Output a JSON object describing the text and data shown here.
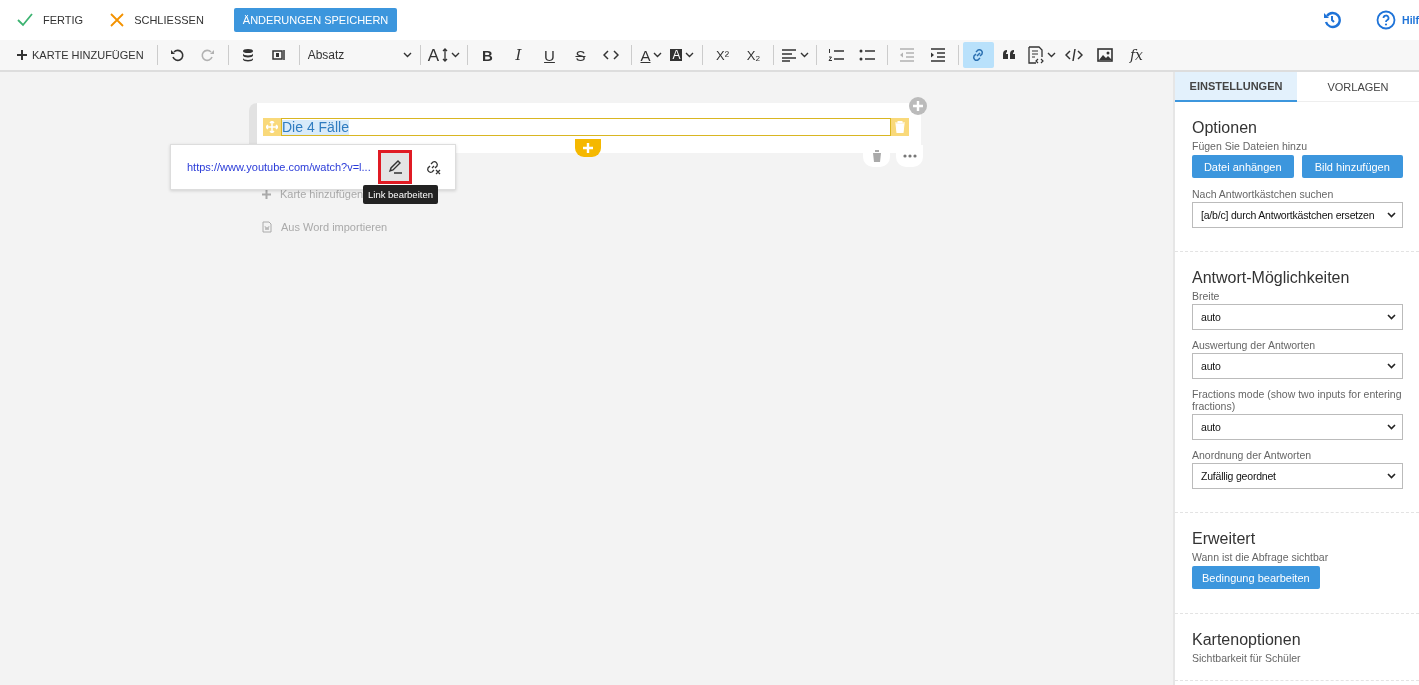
{
  "topbar": {
    "actions": [
      {
        "kind": "done",
        "label": "FERTIG"
      },
      {
        "kind": "close",
        "label": "SCHLIESSEN"
      }
    ],
    "save": "ÄNDERUNGEN SPEICHERN",
    "help": "Hilf"
  },
  "toolbar": {
    "add_card": "KARTE HINZUFÜGEN",
    "format": "Absatz",
    "groups_before": [
      [
        {
          "kind": "undo",
          "disabled": false,
          "selected": false
        },
        {
          "kind": "redo",
          "disabled": true,
          "selected": false
        }
      ],
      [
        {
          "kind": "database",
          "disabled": false,
          "selected": false
        },
        {
          "kind": "device",
          "disabled": false,
          "selected": false
        }
      ]
    ],
    "groups": [
      [
        {
          "kind": "fontsize",
          "text": "A",
          "disabled": false,
          "selected": false
        }
      ],
      [
        {
          "kind": "bold",
          "text": "B",
          "disabled": false,
          "selected": false
        },
        {
          "kind": "italic",
          "text": "I",
          "disabled": false,
          "selected": false
        },
        {
          "kind": "underline",
          "text": "U",
          "disabled": false,
          "selected": false
        },
        {
          "kind": "strike",
          "text": "S",
          "disabled": false,
          "selected": false
        },
        {
          "kind": "code",
          "disabled": false,
          "selected": false
        }
      ],
      [
        {
          "kind": "color",
          "text": "A",
          "disabled": false,
          "selected": false
        },
        {
          "kind": "highlight",
          "text": "A",
          "disabled": false,
          "selected": false
        }
      ],
      [
        {
          "kind": "sup",
          "text": "X²",
          "disabled": false,
          "selected": false
        },
        {
          "kind": "sub",
          "text": "X₂",
          "disabled": false,
          "selected": false
        }
      ],
      [
        {
          "kind": "align",
          "disabled": false,
          "selected": false
        }
      ],
      [
        {
          "kind": "ol",
          "disabled": false,
          "selected": false
        },
        {
          "kind": "ul",
          "disabled": false,
          "selected": false
        }
      ],
      [
        {
          "kind": "outdent",
          "disabled": true,
          "selected": false
        },
        {
          "kind": "indent",
          "disabled": false,
          "selected": false
        }
      ],
      [
        {
          "kind": "link",
          "disabled": false,
          "selected": true
        },
        {
          "kind": "quote",
          "disabled": false,
          "selected": false
        },
        {
          "kind": "template",
          "disabled": false,
          "selected": false
        },
        {
          "kind": "source",
          "disabled": false,
          "selected": false
        },
        {
          "kind": "image",
          "disabled": false,
          "selected": false
        },
        {
          "kind": "formula",
          "text": "fx",
          "disabled": false,
          "selected": false
        }
      ]
    ]
  },
  "card": {
    "title": "Die 4 Fälle",
    "link_popup": {
      "url": "https://www.youtube.com/watch?v=l...",
      "tooltip": "Link bearbeiten"
    },
    "actions": [
      {
        "kind": "add",
        "label": "Karte hinzufügen"
      },
      {
        "kind": "word",
        "label": "Aus Word importieren"
      }
    ]
  },
  "panel": {
    "tabs": [
      {
        "label": "EINSTELLUNGEN",
        "selected": true
      },
      {
        "label": "VORLAGEN",
        "selected": false
      }
    ],
    "sections": [
      {
        "title": "Optionen",
        "fields": [
          {
            "kind": "hint",
            "text": "Fügen Sie Dateien hinzu"
          },
          {
            "kind": "buttons",
            "buttons": [
              "Datei anhängen",
              "Bild hinzufügen"
            ]
          },
          {
            "kind": "select",
            "label": "Nach Antwortkästchen suchen",
            "value": "[a/b/c] durch Antwortkästchen ersetzen"
          }
        ]
      },
      {
        "title": "Antwort-Möglichkeiten",
        "fields": [
          {
            "kind": "select",
            "label": "Breite",
            "value": "auto"
          },
          {
            "kind": "select",
            "label": "Auswertung der Antworten",
            "value": "auto"
          },
          {
            "kind": "select",
            "label": "Fractions mode (show two inputs for entering fractions)",
            "value": "auto"
          },
          {
            "kind": "select",
            "label": "Anordnung der Antworten",
            "value": "Zufällig geordnet"
          }
        ]
      },
      {
        "title": "Erweitert",
        "fields": [
          {
            "kind": "hint",
            "text": "Wann ist die Abfrage sichtbar"
          },
          {
            "kind": "buttons",
            "buttons": [
              "Bedingung bearbeiten"
            ]
          }
        ]
      },
      {
        "title": "Kartenoptionen",
        "fields": [
          {
            "kind": "hint",
            "text": "Sichtbarkeit für Schüler"
          }
        ]
      }
    ]
  }
}
